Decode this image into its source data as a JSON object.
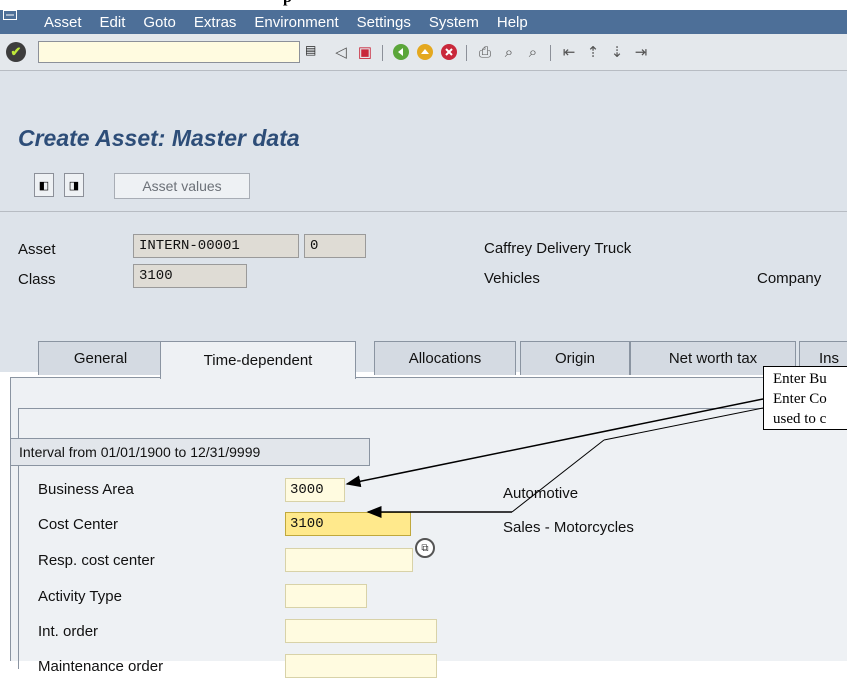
{
  "top_heading_partial": "p",
  "menu": [
    "Asset",
    "Edit",
    "Goto",
    "Extras",
    "Environment",
    "Settings",
    "System",
    "Help"
  ],
  "toolbar": {
    "icons": [
      "enter-icon",
      "command-field",
      "back-arrow-icon",
      "save-icon",
      "back-icon",
      "exit-icon",
      "cancel-icon",
      "print-icon",
      "find-icon",
      "find-next-icon",
      "first-page-icon",
      "previous-page-icon",
      "next-page-icon",
      "last-page-icon"
    ]
  },
  "title": "Create Asset: Master data",
  "app_toolbar": {
    "asset_values_label": "Asset values"
  },
  "header": {
    "asset_label": "Asset",
    "asset_number": "INTERN-00001",
    "sub_number": "0",
    "asset_description": "Caffrey Delivery Truck",
    "class_label": "Class",
    "class_value": "3100",
    "class_description": "Vehicles",
    "company_label": "Company"
  },
  "tabs": [
    {
      "label": "General",
      "active": false
    },
    {
      "label": "Time-dependent",
      "active": true
    },
    {
      "label": "Allocations",
      "active": false
    },
    {
      "label": "Origin",
      "active": false
    },
    {
      "label": "Net worth tax",
      "active": false
    },
    {
      "label": "Ins",
      "active": false
    }
  ],
  "interval_group_title": "Interval from 01/01/1900 to 12/31/9999",
  "fields": {
    "business_area": {
      "label": "Business Area",
      "value": "3000",
      "description": "Automotive"
    },
    "cost_center": {
      "label": "Cost Center",
      "value": "3100",
      "description": "Sales - Motorcycles"
    },
    "resp_cost_center": {
      "label": "Resp. cost center",
      "value": ""
    },
    "activity_type": {
      "label": "Activity Type",
      "value": ""
    },
    "int_order": {
      "label": "Int. order",
      "value": ""
    },
    "maintenance_order": {
      "label": "Maintenance order",
      "value": ""
    }
  },
  "callout": {
    "line1": "Enter Bu",
    "line2": "Enter Co",
    "line3": "used to c"
  },
  "colors": {
    "menu_bar": "#4d6f98",
    "title_text": "#2d4d78",
    "input_bg": "#fffbe0",
    "focused_input_bg": "#ffe98c",
    "background": "#dde3ea"
  }
}
